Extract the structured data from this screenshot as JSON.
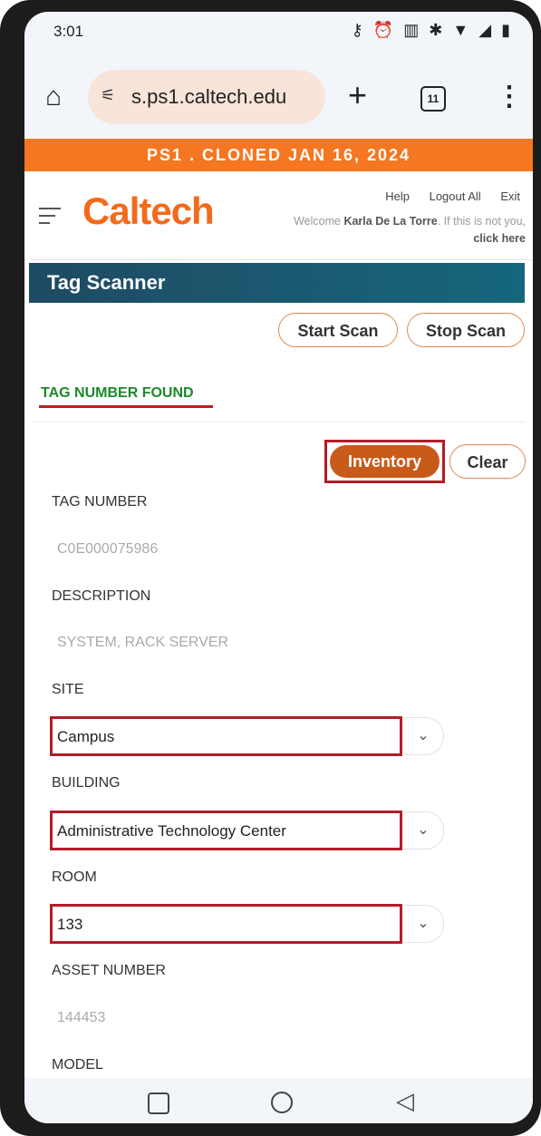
{
  "status_bar": {
    "time": "3:01",
    "icons": "key alarm vibrate bluetooth wifi signal battery"
  },
  "browser": {
    "url": "s.ps1.caltech.edu",
    "tab_count": "11"
  },
  "banner": "PS1 . CLONED JAN 16, 2024",
  "header": {
    "logo": "Caltech",
    "links": [
      "Help",
      "Logout All",
      "Exit"
    ],
    "welcome_prefix": "Welcome ",
    "user_name": "Karla De La Torre",
    "welcome_suffix": ". If this is not you, ",
    "click_here": "click here"
  },
  "panel": {
    "title": "Tag Scanner",
    "start_scan": "Start Scan",
    "stop_scan": "Stop Scan",
    "status": "TAG NUMBER FOUND",
    "inventory": "Inventory",
    "clear": "Clear"
  },
  "fields": {
    "tag_number_label": "TAG NUMBER",
    "tag_number": "C0E000075986",
    "description_label": "DESCRIPTION",
    "description": "SYSTEM, RACK SERVER",
    "site_label": "SITE",
    "site": "Campus",
    "building_label": "BUILDING",
    "building": "Administrative Technology Center",
    "room_label": "ROOM",
    "room": "133",
    "asset_number_label": "ASSET NUMBER",
    "asset_number": "144453",
    "model_label": "MODEL"
  },
  "icons": {
    "home": "home-icon",
    "site_settings": "tune-icon",
    "new_tab": "plus-icon",
    "menu": "more-vert-icon",
    "dropdown": "chevron-down-icon"
  }
}
